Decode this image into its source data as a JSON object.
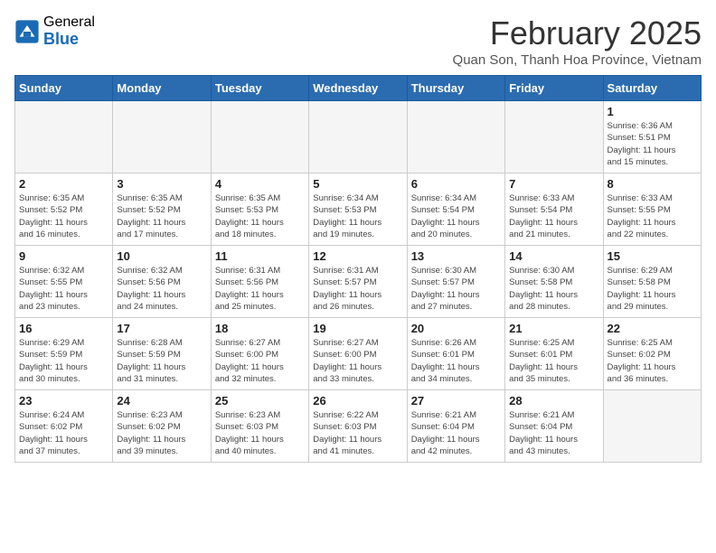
{
  "logo": {
    "general": "General",
    "blue": "Blue"
  },
  "title": "February 2025",
  "location": "Quan Son, Thanh Hoa Province, Vietnam",
  "days_header": [
    "Sunday",
    "Monday",
    "Tuesday",
    "Wednesday",
    "Thursday",
    "Friday",
    "Saturday"
  ],
  "weeks": [
    [
      {
        "day": "",
        "info": ""
      },
      {
        "day": "",
        "info": ""
      },
      {
        "day": "",
        "info": ""
      },
      {
        "day": "",
        "info": ""
      },
      {
        "day": "",
        "info": ""
      },
      {
        "day": "",
        "info": ""
      },
      {
        "day": "1",
        "info": "Sunrise: 6:36 AM\nSunset: 5:51 PM\nDaylight: 11 hours\nand 15 minutes."
      }
    ],
    [
      {
        "day": "2",
        "info": "Sunrise: 6:35 AM\nSunset: 5:52 PM\nDaylight: 11 hours\nand 16 minutes."
      },
      {
        "day": "3",
        "info": "Sunrise: 6:35 AM\nSunset: 5:52 PM\nDaylight: 11 hours\nand 17 minutes."
      },
      {
        "day": "4",
        "info": "Sunrise: 6:35 AM\nSunset: 5:53 PM\nDaylight: 11 hours\nand 18 minutes."
      },
      {
        "day": "5",
        "info": "Sunrise: 6:34 AM\nSunset: 5:53 PM\nDaylight: 11 hours\nand 19 minutes."
      },
      {
        "day": "6",
        "info": "Sunrise: 6:34 AM\nSunset: 5:54 PM\nDaylight: 11 hours\nand 20 minutes."
      },
      {
        "day": "7",
        "info": "Sunrise: 6:33 AM\nSunset: 5:54 PM\nDaylight: 11 hours\nand 21 minutes."
      },
      {
        "day": "8",
        "info": "Sunrise: 6:33 AM\nSunset: 5:55 PM\nDaylight: 11 hours\nand 22 minutes."
      }
    ],
    [
      {
        "day": "9",
        "info": "Sunrise: 6:32 AM\nSunset: 5:55 PM\nDaylight: 11 hours\nand 23 minutes."
      },
      {
        "day": "10",
        "info": "Sunrise: 6:32 AM\nSunset: 5:56 PM\nDaylight: 11 hours\nand 24 minutes."
      },
      {
        "day": "11",
        "info": "Sunrise: 6:31 AM\nSunset: 5:56 PM\nDaylight: 11 hours\nand 25 minutes."
      },
      {
        "day": "12",
        "info": "Sunrise: 6:31 AM\nSunset: 5:57 PM\nDaylight: 11 hours\nand 26 minutes."
      },
      {
        "day": "13",
        "info": "Sunrise: 6:30 AM\nSunset: 5:57 PM\nDaylight: 11 hours\nand 27 minutes."
      },
      {
        "day": "14",
        "info": "Sunrise: 6:30 AM\nSunset: 5:58 PM\nDaylight: 11 hours\nand 28 minutes."
      },
      {
        "day": "15",
        "info": "Sunrise: 6:29 AM\nSunset: 5:58 PM\nDaylight: 11 hours\nand 29 minutes."
      }
    ],
    [
      {
        "day": "16",
        "info": "Sunrise: 6:29 AM\nSunset: 5:59 PM\nDaylight: 11 hours\nand 30 minutes."
      },
      {
        "day": "17",
        "info": "Sunrise: 6:28 AM\nSunset: 5:59 PM\nDaylight: 11 hours\nand 31 minutes."
      },
      {
        "day": "18",
        "info": "Sunrise: 6:27 AM\nSunset: 6:00 PM\nDaylight: 11 hours\nand 32 minutes."
      },
      {
        "day": "19",
        "info": "Sunrise: 6:27 AM\nSunset: 6:00 PM\nDaylight: 11 hours\nand 33 minutes."
      },
      {
        "day": "20",
        "info": "Sunrise: 6:26 AM\nSunset: 6:01 PM\nDaylight: 11 hours\nand 34 minutes."
      },
      {
        "day": "21",
        "info": "Sunrise: 6:25 AM\nSunset: 6:01 PM\nDaylight: 11 hours\nand 35 minutes."
      },
      {
        "day": "22",
        "info": "Sunrise: 6:25 AM\nSunset: 6:02 PM\nDaylight: 11 hours\nand 36 minutes."
      }
    ],
    [
      {
        "day": "23",
        "info": "Sunrise: 6:24 AM\nSunset: 6:02 PM\nDaylight: 11 hours\nand 37 minutes."
      },
      {
        "day": "24",
        "info": "Sunrise: 6:23 AM\nSunset: 6:02 PM\nDaylight: 11 hours\nand 39 minutes."
      },
      {
        "day": "25",
        "info": "Sunrise: 6:23 AM\nSunset: 6:03 PM\nDaylight: 11 hours\nand 40 minutes."
      },
      {
        "day": "26",
        "info": "Sunrise: 6:22 AM\nSunset: 6:03 PM\nDaylight: 11 hours\nand 41 minutes."
      },
      {
        "day": "27",
        "info": "Sunrise: 6:21 AM\nSunset: 6:04 PM\nDaylight: 11 hours\nand 42 minutes."
      },
      {
        "day": "28",
        "info": "Sunrise: 6:21 AM\nSunset: 6:04 PM\nDaylight: 11 hours\nand 43 minutes."
      },
      {
        "day": "",
        "info": ""
      }
    ]
  ]
}
